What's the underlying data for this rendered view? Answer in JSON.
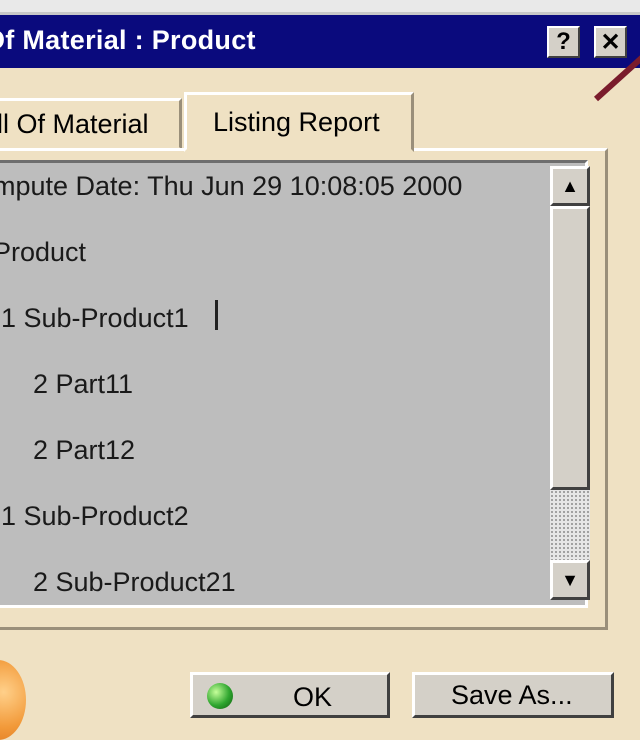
{
  "window": {
    "title": "Of Material : Product",
    "help_label": "?",
    "close_label": "✕"
  },
  "tabs": [
    {
      "label": "ill Of Material",
      "active": false
    },
    {
      "label": "Listing Report",
      "active": true
    }
  ],
  "report": {
    "lines": [
      "mpute Date: Thu Jun 29 10:08:05 2000",
      "Product",
      "1 Sub-Product1",
      "2 Part11",
      "2 Part12",
      "1 Sub-Product2",
      "2 Sub-Product21"
    ]
  },
  "scrollbar": {
    "up_icon": "▲",
    "down_icon": "▼"
  },
  "buttons": {
    "ok_label": "OK",
    "saveas_label": "Save As..."
  },
  "colors": {
    "titlebar": "#0a0a7d",
    "dialog_bg": "#efe1c3",
    "report_bg": "#bdbdbd",
    "button_face": "#d4d0c8"
  }
}
